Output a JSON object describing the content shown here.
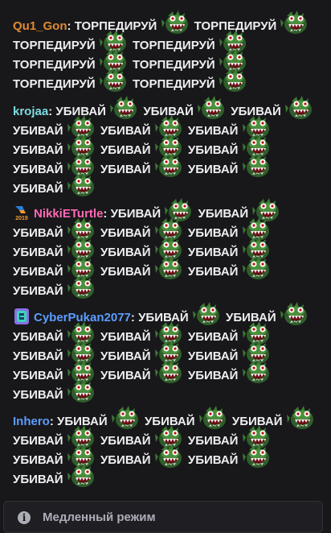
{
  "chat": {
    "messages": [
      {
        "username": "Qu1_Gon",
        "username_color": "#e08a30",
        "badge": null,
        "lines": [
          [
            {
              "t": "ТОРПЕДИРУЙ"
            },
            {
              "e": "fish"
            },
            {
              "t": "ТОРПЕДИРУЙ"
            },
            {
              "e": "fish"
            }
          ],
          [
            {
              "t": "ТОРПЕДИРУЙ"
            },
            {
              "e": "fish"
            },
            {
              "t": "ТОРПЕДИРУЙ"
            },
            {
              "e": "fish"
            }
          ],
          [
            {
              "t": "ТОРПЕДИРУЙ"
            },
            {
              "e": "fish"
            },
            {
              "t": "ТОРПЕДИРУЙ"
            },
            {
              "e": "fish"
            }
          ],
          [
            {
              "t": "ТОРПЕДИРУЙ"
            },
            {
              "e": "fish"
            },
            {
              "t": "ТОРПЕДИРУЙ"
            },
            {
              "e": "fish"
            }
          ]
        ]
      },
      {
        "username": "krojaa",
        "username_color": "#7fdbe0",
        "badge": null,
        "lines": [
          [
            {
              "t": "УБИВАЙ"
            },
            {
              "e": "fish"
            },
            {
              "t": "УБИВАЙ"
            },
            {
              "e": "fish"
            },
            {
              "t": "УБИВАЙ"
            },
            {
              "e": "fish"
            }
          ],
          [
            {
              "t": "УБИВАЙ"
            },
            {
              "e": "fish"
            },
            {
              "t": "УБИВАЙ"
            },
            {
              "e": "fish"
            },
            {
              "t": "УБИВАЙ"
            },
            {
              "e": "fish"
            }
          ],
          [
            {
              "t": "УБИВАЙ"
            },
            {
              "e": "fish"
            },
            {
              "t": "УБИВАЙ"
            },
            {
              "e": "fish"
            },
            {
              "t": "УБИВАЙ"
            },
            {
              "e": "fish"
            }
          ],
          [
            {
              "t": "УБИВАЙ"
            },
            {
              "e": "fish"
            },
            {
              "t": "УБИВАЙ"
            },
            {
              "e": "fish"
            },
            {
              "t": "УБИВАЙ"
            },
            {
              "e": "fish"
            }
          ],
          [
            {
              "t": "УБИВАЙ"
            },
            {
              "e": "fish"
            }
          ]
        ]
      },
      {
        "username": "NikkiETurtle",
        "username_color": "#ff69b4",
        "badge": {
          "name": "2019-badge-icon",
          "text": "2019"
        },
        "lines": [
          [
            {
              "t": "УБИВАЙ"
            },
            {
              "e": "fish"
            },
            {
              "t": "УБИВАЙ"
            },
            {
              "e": "fish"
            }
          ],
          [
            {
              "t": "УБИВАЙ"
            },
            {
              "e": "fish"
            },
            {
              "t": "УБИВАЙ"
            },
            {
              "e": "fish"
            },
            {
              "t": "УБИВАЙ"
            },
            {
              "e": "fish"
            }
          ],
          [
            {
              "t": "УБИВАЙ"
            },
            {
              "e": "fish"
            },
            {
              "t": "УБИВАЙ"
            },
            {
              "e": "fish"
            },
            {
              "t": "УБИВАЙ"
            },
            {
              "e": "fish"
            }
          ],
          [
            {
              "t": "УБИВАЙ"
            },
            {
              "e": "fish"
            },
            {
              "t": "УБИВАЙ"
            },
            {
              "e": "fish"
            },
            {
              "t": "УБИВАЙ"
            },
            {
              "e": "fish"
            }
          ],
          [
            {
              "t": "УБИВАЙ"
            },
            {
              "e": "fish"
            }
          ]
        ]
      },
      {
        "username": "CyberPukan2077",
        "username_color": "#5c9dff",
        "badge": {
          "name": "subscriber-badge-icon",
          "text": ""
        },
        "lines": [
          [
            {
              "t": "УБИВАЙ"
            },
            {
              "e": "fish"
            },
            {
              "t": "УБИВАЙ"
            },
            {
              "e": "fish"
            }
          ],
          [
            {
              "t": "УБИВАЙ"
            },
            {
              "e": "fish"
            },
            {
              "t": "УБИВАЙ"
            },
            {
              "e": "fish"
            },
            {
              "t": "УБИВАЙ"
            },
            {
              "e": "fish"
            }
          ],
          [
            {
              "t": "УБИВАЙ"
            },
            {
              "e": "fish"
            },
            {
              "t": "УБИВАЙ"
            },
            {
              "e": "fish"
            },
            {
              "t": "УБИВАЙ"
            },
            {
              "e": "fish"
            }
          ],
          [
            {
              "t": "УБИВАЙ"
            },
            {
              "e": "fish"
            },
            {
              "t": "УБИВАЙ"
            },
            {
              "e": "fish"
            },
            {
              "t": "УБИВАЙ"
            },
            {
              "e": "fish"
            }
          ],
          [
            {
              "t": "УБИВАЙ"
            },
            {
              "e": "fish"
            }
          ]
        ]
      },
      {
        "username": "Inhero",
        "username_color": "#5c9dff",
        "badge": null,
        "lines": [
          [
            {
              "t": "УБИВАЙ"
            },
            {
              "e": "fish"
            },
            {
              "t": "УБИВАЙ"
            },
            {
              "e": "fish"
            },
            {
              "t": "УБИВАЙ"
            },
            {
              "e": "fish"
            }
          ],
          [
            {
              "t": "УБИВАЙ"
            },
            {
              "e": "fish"
            },
            {
              "t": "УБИВАЙ"
            },
            {
              "e": "fish"
            },
            {
              "t": "УБИВАЙ"
            },
            {
              "e": "fish"
            }
          ],
          [
            {
              "t": "УБИВАЙ"
            },
            {
              "e": "fish"
            },
            {
              "t": "УБИВАЙ"
            },
            {
              "e": "fish"
            },
            {
              "t": "УБИВАЙ"
            },
            {
              "e": "fish"
            }
          ],
          [
            {
              "t": "УБИВАЙ"
            },
            {
              "e": "fish"
            }
          ]
        ]
      }
    ],
    "emote_icon": "piranha-emote-icon",
    "text_color": "#efeff1",
    "background": "#18181b"
  },
  "slow_mode": {
    "icon": "info-icon",
    "icon_glyph": "i",
    "label": "Медленный режим"
  }
}
